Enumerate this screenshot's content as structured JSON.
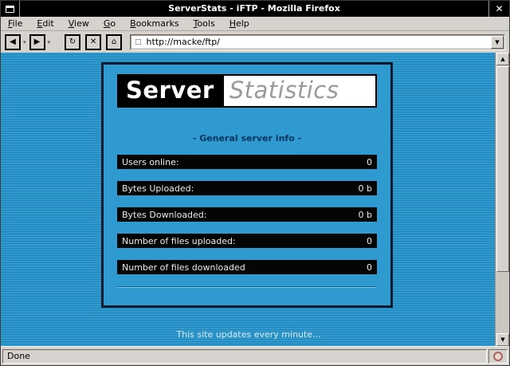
{
  "window": {
    "title": "ServerStats - iFTP - Mozilla Firefox",
    "close_icon": "✕"
  },
  "menubar": {
    "items": [
      {
        "accel": "F",
        "rest": "ile"
      },
      {
        "accel": "E",
        "rest": "dit"
      },
      {
        "accel": "V",
        "rest": "iew"
      },
      {
        "accel": "G",
        "rest": "o"
      },
      {
        "accel": "B",
        "rest": "ookmarks"
      },
      {
        "accel": "T",
        "rest": "ools"
      },
      {
        "accel": "H",
        "rest": "elp"
      }
    ]
  },
  "toolbar": {
    "back_icon": "◀",
    "forward_icon": "▶",
    "reload_icon": "↻",
    "stop_icon": "✕",
    "home_icon": "⌂",
    "dropdown_icon": "▾",
    "url_proxy_icon": "□",
    "url": "http://macke/ftp/",
    "url_dropdown_icon": "▼"
  },
  "content": {
    "logo": {
      "left": "Server",
      "right": "Statistics"
    },
    "section_title": "- General server info -",
    "stats": [
      {
        "label": "Users online:",
        "value": "0"
      },
      {
        "label": "Bytes Uploaded:",
        "value": "0 b"
      },
      {
        "label": "Bytes Downloaded:",
        "value": "0 b"
      },
      {
        "label": "Number of files uploaded:",
        "value": "0"
      },
      {
        "label": "Number of files downloaded",
        "value": "0"
      }
    ],
    "footer_note": "This site updates every minute..."
  },
  "scrollbar": {
    "up_icon": "▲",
    "down_icon": "▼"
  },
  "statusbar": {
    "text": "Done"
  },
  "colors": {
    "page_blue": "#2f9ad0",
    "stripe_blue": "#2384b6",
    "box_border": "#0b1b2f",
    "heading_navy": "#06355c",
    "bar_black": "#050505",
    "statistics_gray": "#9a9a9a",
    "footer_text": "#d9e9f2"
  }
}
